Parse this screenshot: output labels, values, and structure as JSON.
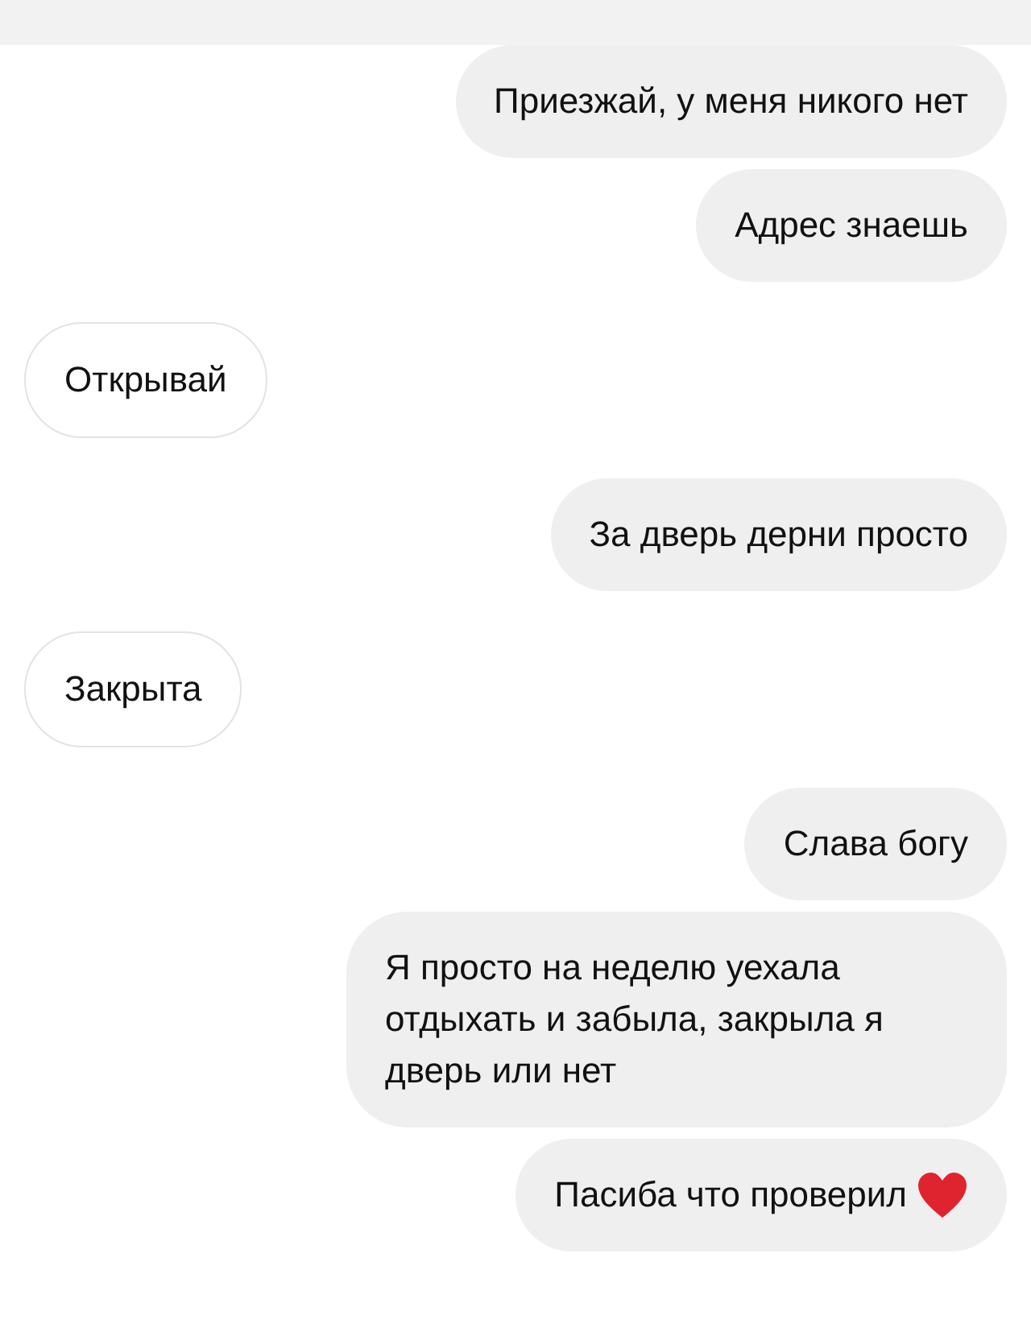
{
  "messages": [
    {
      "kind": "outgoing",
      "text": "Приезжай, у меня никого нет"
    },
    {
      "kind": "outgoing",
      "text": "Адрес знаешь"
    },
    {
      "kind": "incoming",
      "text": "Открывай"
    },
    {
      "kind": "outgoing",
      "text": "За дверь дерни просто"
    },
    {
      "kind": "incoming",
      "text": "Закрыта"
    },
    {
      "kind": "outgoing",
      "text": "Слава богу"
    },
    {
      "kind": "outgoing",
      "text": "Я просто на неделю уехала отдыхать и забыла, закрыла я дверь или нет"
    },
    {
      "kind": "outgoing",
      "text": "Пасиба что проверил",
      "heart": true
    }
  ]
}
